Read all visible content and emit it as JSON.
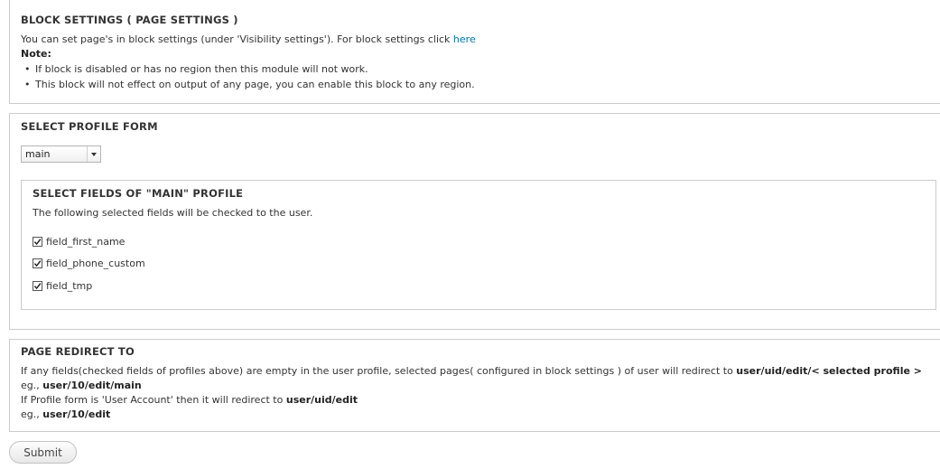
{
  "block_settings": {
    "legend": "BLOCK SETTINGS ( PAGE SETTINGS )",
    "intro": "You can set page's in block settings (under 'Visibility settings'). For block settings click ",
    "link": "here",
    "note_label": "Note:",
    "notes": [
      "If block is disabled or has no region then this module will not work.",
      "This block will not effect on output of any page, you can enable this block to any region."
    ]
  },
  "profile_form": {
    "legend": "SELECT PROFILE FORM",
    "selected": "main",
    "fields": {
      "legend": "SELECT FIELDS OF \"MAIN\" PROFILE",
      "description": "The following selected fields will be checked to the user.",
      "items": [
        {
          "label": "field_first_name",
          "checked": true
        },
        {
          "label": "field_phone_custom",
          "checked": true
        },
        {
          "label": "field_tmp",
          "checked": true
        }
      ]
    }
  },
  "page_redirect": {
    "legend": "PAGE REDIRECT TO",
    "line1": "If any fields(checked fields of profiles above) are empty in the user profile, selected pages( configured in block settings ) of user will redirect to ",
    "line1_bold": "user/uid/edit/< selected profile >",
    "line2_prefix": "eg., ",
    "line2_bold": "user/10/edit/main",
    "line3": "If Profile form is 'User Account' then it will redirect to ",
    "line3_bold": "user/uid/edit",
    "line4_prefix": "eg., ",
    "line4_bold": "user/10/edit"
  },
  "submit_label": "Submit"
}
